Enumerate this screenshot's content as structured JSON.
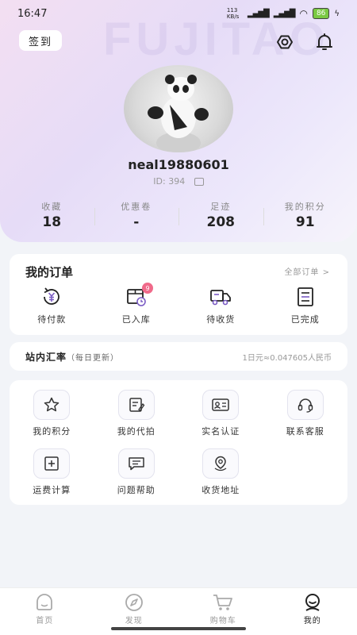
{
  "status": {
    "time": "16:47",
    "net_speed": "113 KB/s",
    "battery": "86"
  },
  "header": {
    "checkin_label": "签到",
    "watermark": "FUJITAO"
  },
  "profile": {
    "username": "neal19880601",
    "id_text": "ID: 394"
  },
  "stats": [
    {
      "label": "收藏",
      "value": "18"
    },
    {
      "label": "优惠卷",
      "value": "-"
    },
    {
      "label": "足迹",
      "value": "208"
    },
    {
      "label": "我的积分",
      "value": "91"
    }
  ],
  "orders": {
    "title": "我的订单",
    "all_label": "全部订单 >",
    "items": [
      {
        "label": "待付款",
        "icon": "yen-payment-icon"
      },
      {
        "label": "已入库",
        "icon": "warehouse-icon",
        "badge": "9"
      },
      {
        "label": "待收货",
        "icon": "truck-icon"
      },
      {
        "label": "已完成",
        "icon": "document-done-icon"
      }
    ]
  },
  "rate": {
    "title": "站内汇率",
    "note": "（每日更新）",
    "value": "1日元≈0.047605人民币"
  },
  "menu": [
    {
      "label": "我的积分",
      "icon": "star-icon"
    },
    {
      "label": "我的代拍",
      "icon": "edit-note-icon"
    },
    {
      "label": "实名认证",
      "icon": "id-card-icon"
    },
    {
      "label": "联系客服",
      "icon": "headset-icon"
    },
    {
      "label": "运费计算",
      "icon": "calculator-icon"
    },
    {
      "label": "问题帮助",
      "icon": "chat-icon"
    },
    {
      "label": "收货地址",
      "icon": "location-icon"
    }
  ],
  "tabs": [
    {
      "label": "首页",
      "icon": "home-icon"
    },
    {
      "label": "发现",
      "icon": "compass-icon"
    },
    {
      "label": "购物车",
      "icon": "cart-icon"
    },
    {
      "label": "我的",
      "icon": "profile-icon"
    }
  ],
  "colors": {
    "accent": "#7b5cc4",
    "badge": "#f06a8a",
    "header_bg": "#e6dcf7"
  }
}
